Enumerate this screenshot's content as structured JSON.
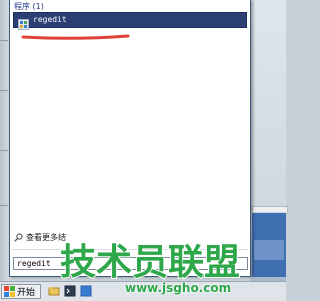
{
  "start_menu": {
    "programs_header": "程序 (1)",
    "result": {
      "label": "regedit",
      "icon": "regedit-icon"
    },
    "see_more_label": "查看更多结",
    "search_value": "regedit"
  },
  "taskbar": {
    "start_label": "开始"
  },
  "watermark": {
    "text": "技术员联盟",
    "url": "www.jsgho.com"
  },
  "colors": {
    "selection": "#2b3f75",
    "header_text": "#1e3a8a",
    "underline": "#e0403a",
    "watermark": "#2ea84a"
  }
}
